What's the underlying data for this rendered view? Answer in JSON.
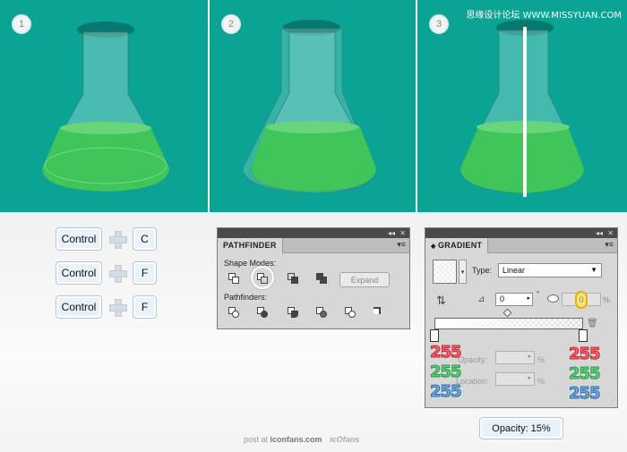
{
  "steps": [
    "1",
    "2",
    "3"
  ],
  "watermark": "思缘设计论坛 WWW.MISSYUAN.COM",
  "shortcuts": [
    {
      "key1": "Control",
      "key2": "C"
    },
    {
      "key1": "Control",
      "key2": "F"
    },
    {
      "key1": "Control",
      "key2": "F"
    }
  ],
  "pathfinder": {
    "tab_label": "PATHFINDER",
    "shape_modes_label": "Shape Modes:",
    "expand_label": "Expand",
    "pathfinders_label": "Pathfinders:",
    "collapse_glyph": "◂◂",
    "close_glyph": "✕",
    "menu_glyph": "▾≡"
  },
  "gradient": {
    "tab_label": "GRADIENT",
    "type_label": "Type:",
    "type_value": "Linear",
    "angle_value": "0",
    "aspect_unit": "%",
    "opacity_label": "Opacity:",
    "location_label": "Location:",
    "percent": "%",
    "left_stop": {
      "r": "255",
      "g": "255",
      "b": "255"
    },
    "right_stop": {
      "r": "255",
      "g": "255",
      "b": "255"
    },
    "collapse_glyph": "◂◂",
    "close_glyph": "✕",
    "menu_glyph": "▾≡",
    "marker": "0"
  },
  "callout": "Opacity: 15%",
  "footer": {
    "prefix": "post at ",
    "site": "iconfans.com",
    "logo": "icOfans"
  },
  "colors": {
    "teal": "#0aa394",
    "liquid": "#3fc55a"
  }
}
